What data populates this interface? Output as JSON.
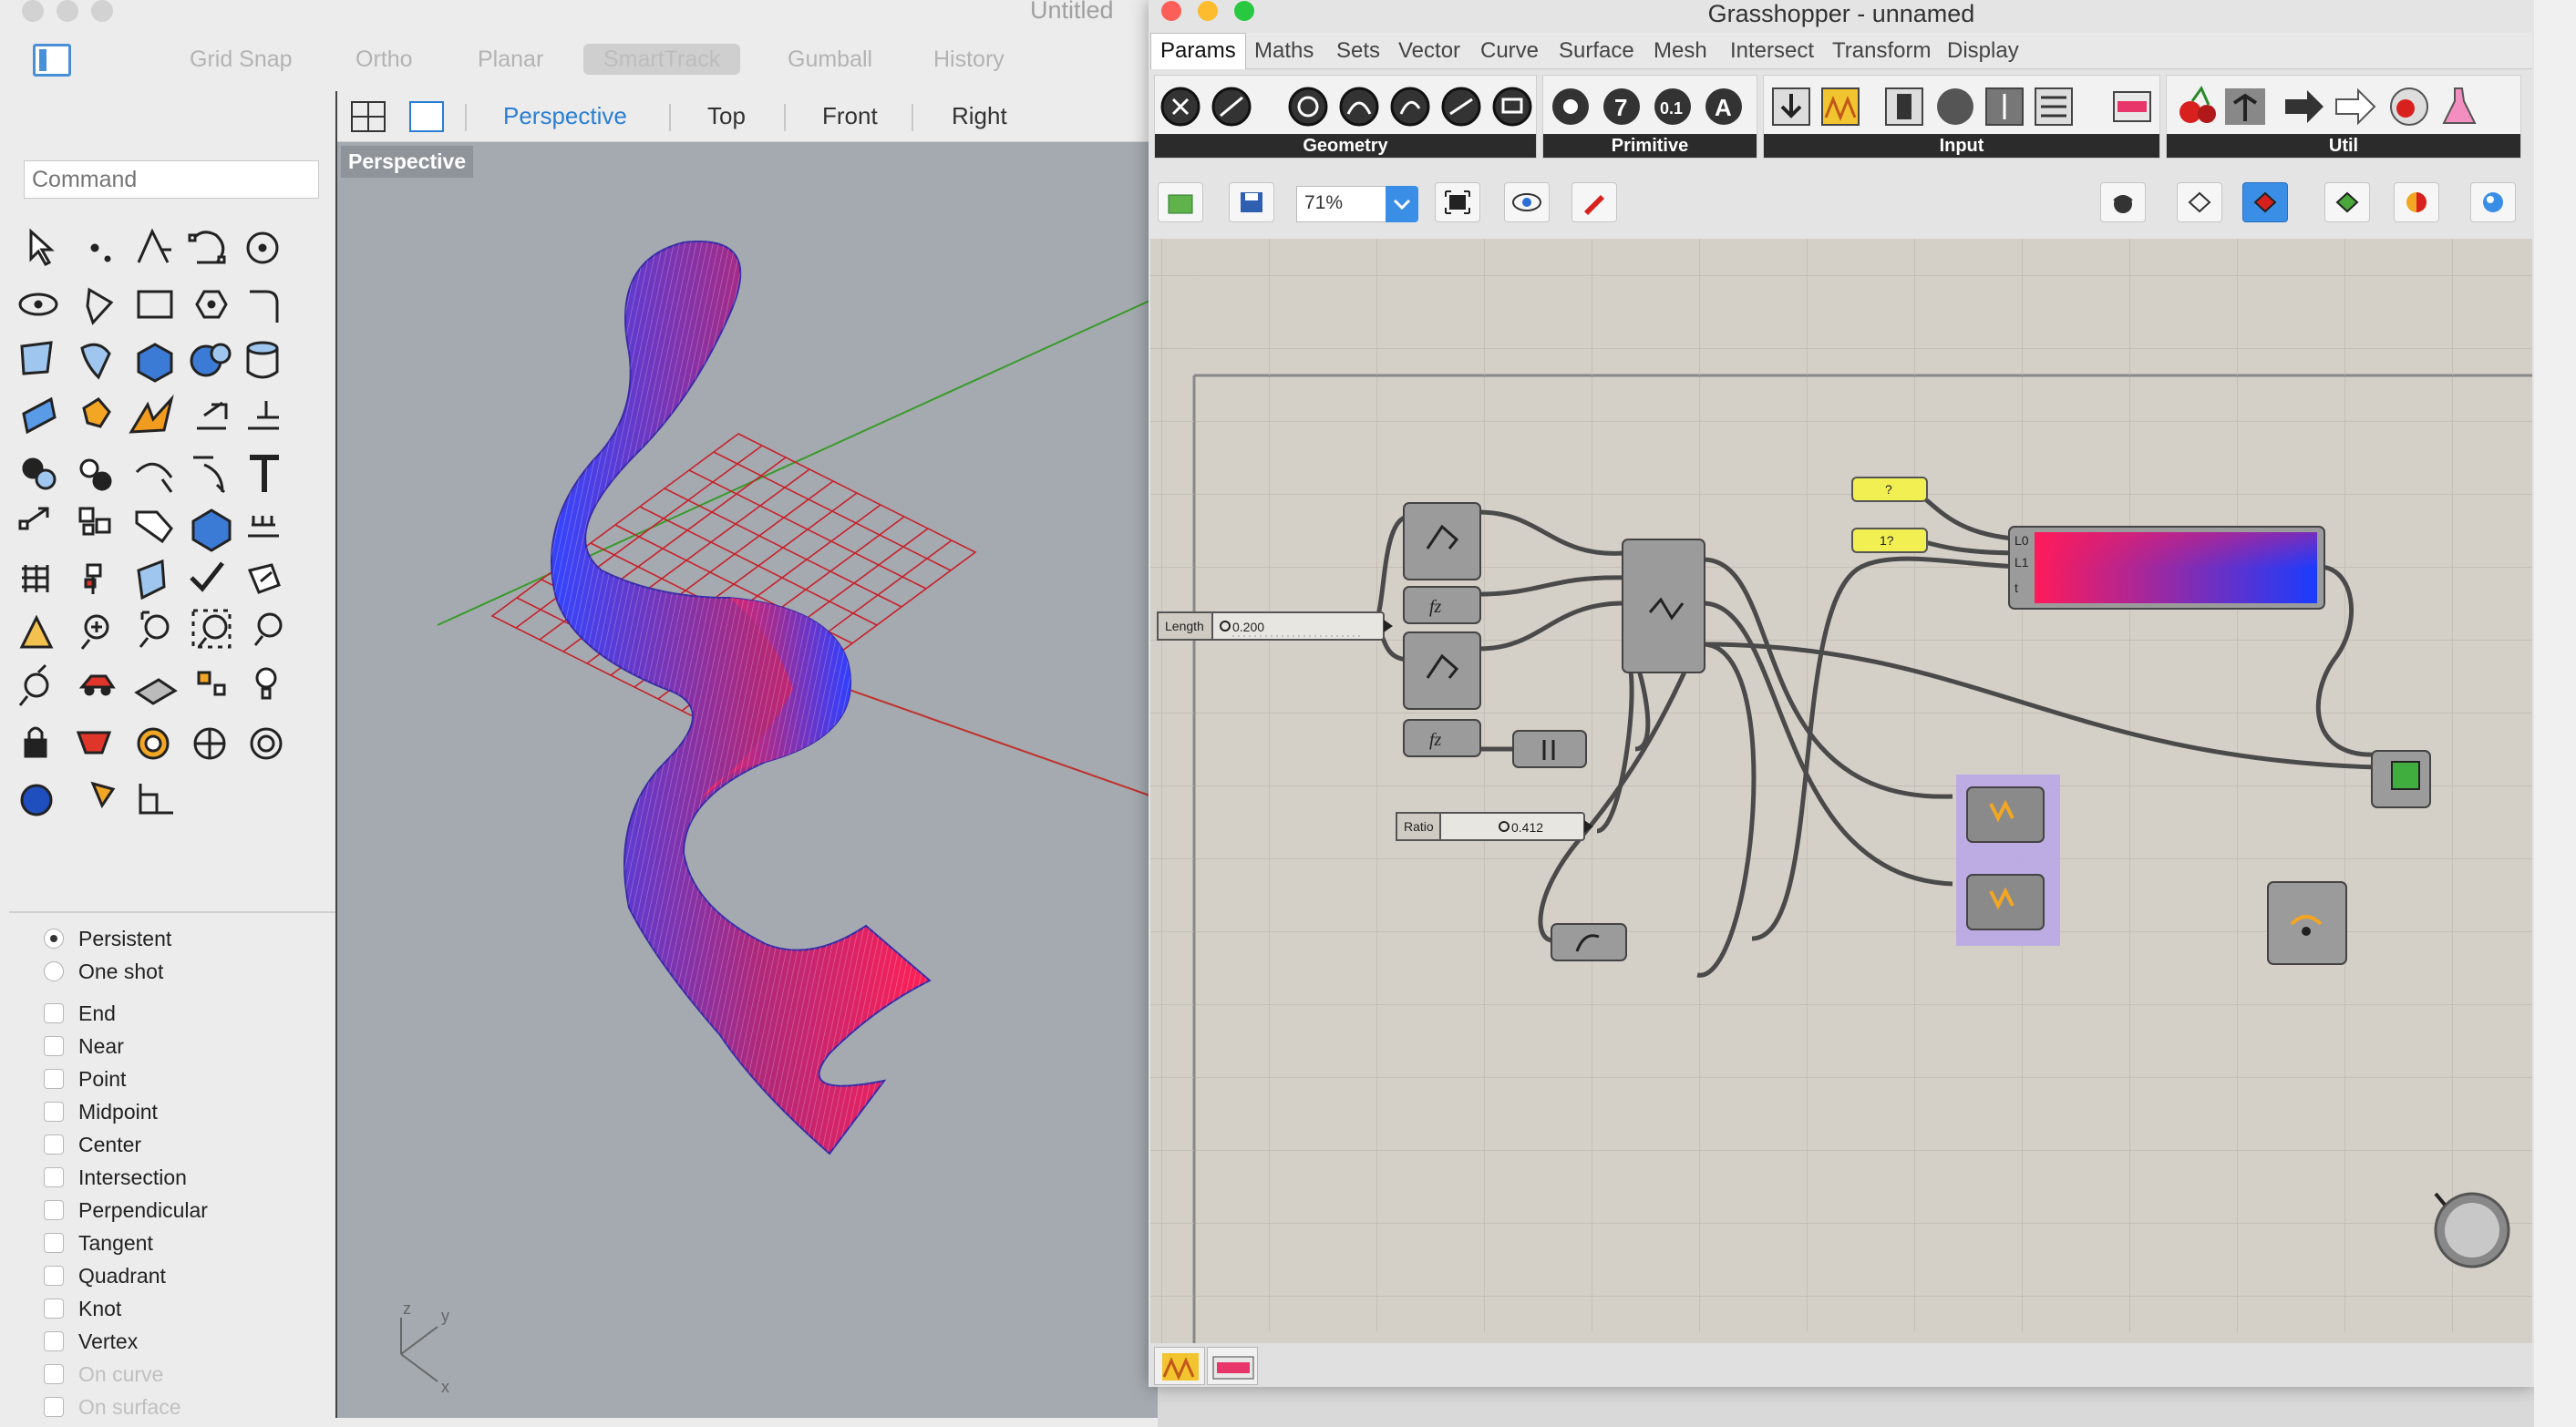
{
  "rhino": {
    "title": "Untitled",
    "modes": [
      "Grid Snap",
      "Ortho",
      "Planar",
      "SmartTrack",
      "Gumball",
      "History"
    ],
    "command_placeholder": "Command",
    "viewport_tabs": [
      "Perspective",
      "Top",
      "Front",
      "Right"
    ],
    "active_viewport_label": "Perspective",
    "osnap_radio": [
      "Persistent",
      "One shot"
    ],
    "osnaps": [
      "End",
      "Near",
      "Point",
      "Midpoint",
      "Center",
      "Intersection",
      "Perpendicular",
      "Tangent",
      "Quadrant",
      "Knot",
      "Vertex"
    ],
    "osnaps_disabled": [
      "On curve",
      "On surface"
    ],
    "axis_labels": {
      "z": "z",
      "y": "y",
      "x": "x"
    }
  },
  "grasshopper": {
    "title": "Grasshopper - unnamed",
    "menus": [
      "Params",
      "Maths",
      "Sets",
      "Vector",
      "Curve",
      "Surface",
      "Mesh",
      "Intersect",
      "Transform",
      "Display"
    ],
    "ribbon_groups": [
      "Geometry",
      "Primitive",
      "Input",
      "Util"
    ],
    "zoom": "71%",
    "sliders": {
      "length": {
        "label": "Length",
        "value": "0.200"
      },
      "ratio": {
        "label": "Ratio",
        "value": "0.412"
      }
    },
    "panels": [
      "?",
      "1?"
    ],
    "gradient_ports": {
      "in": [
        "L0",
        "L1",
        "t"
      ]
    },
    "colors": {
      "gradient_start": "#ff1a5a",
      "gradient_end": "#1a3cff",
      "group_highlight": "#b9a6e8"
    }
  }
}
